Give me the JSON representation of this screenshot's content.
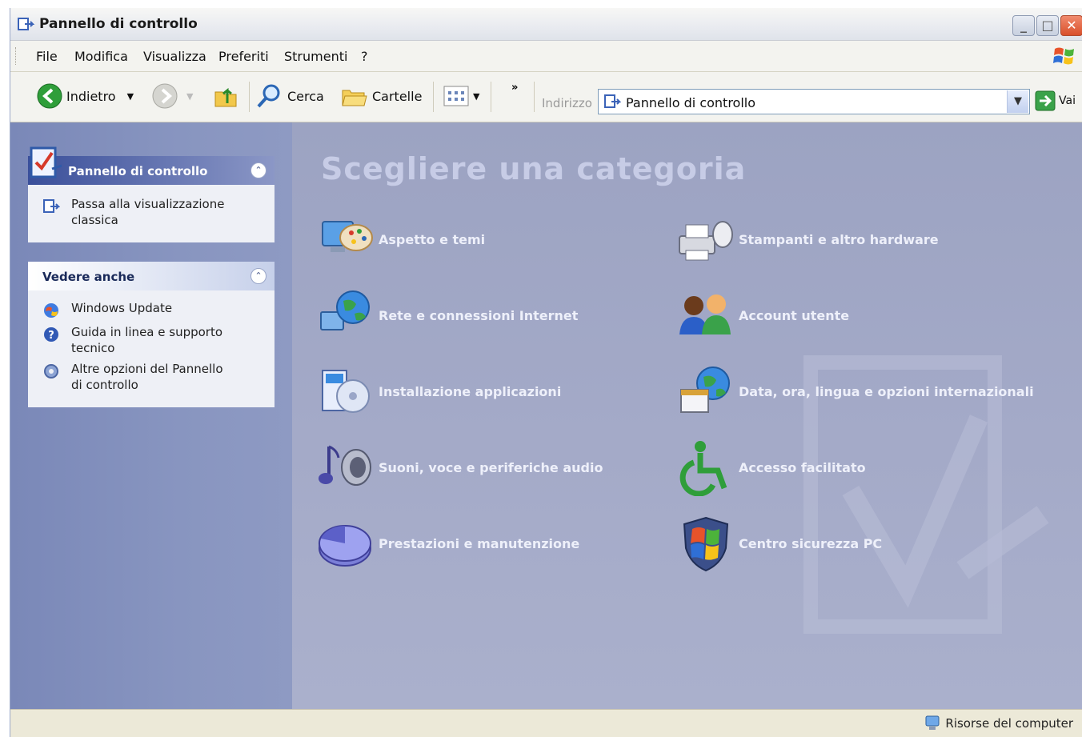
{
  "window": {
    "title": "Pannello di controllo"
  },
  "menubar": {
    "items": [
      "File",
      "Modifica",
      "Visualizza",
      "Preferiti",
      "Strumenti",
      "?"
    ]
  },
  "toolbar": {
    "back_label": "Indietro",
    "search_label": "Cerca",
    "folders_label": "Cartelle",
    "more": "»",
    "address_label": "Indirizzo",
    "address_value": "Pannello di controllo",
    "go_label": "Vai"
  },
  "sidebar": {
    "panel1": {
      "title": "Pannello di controllo",
      "link": "Passa alla visualizzazione classica"
    },
    "panel2": {
      "title": "Vedere anche",
      "links": [
        "Windows Update",
        "Guida in linea e supporto tecnico",
        "Altre opzioni del Pannello di controllo"
      ]
    }
  },
  "main": {
    "heading": "Scegliere una categoria",
    "categories": [
      {
        "label": "Aspetto e temi",
        "icon": "appearance-themes-icon"
      },
      {
        "label": "Stampanti e altro hardware",
        "icon": "printers-hardware-icon"
      },
      {
        "label": "Rete e connessioni Internet",
        "icon": "network-internet-icon"
      },
      {
        "label": "Account utente",
        "icon": "user-accounts-icon"
      },
      {
        "label": "Installazione applicazioni",
        "icon": "add-remove-programs-icon"
      },
      {
        "label": "Data, ora, lingua e opzioni internazionali",
        "icon": "date-time-language-icon"
      },
      {
        "label": "Suoni, voce e periferiche audio",
        "icon": "sounds-audio-icon"
      },
      {
        "label": "Accesso facilitato",
        "icon": "accessibility-icon"
      },
      {
        "label": "Prestazioni e manutenzione",
        "icon": "performance-maintenance-icon"
      },
      {
        "label": "Centro sicurezza PC",
        "icon": "security-center-icon"
      }
    ]
  },
  "statusbar": {
    "text": "Risorse del computer"
  }
}
